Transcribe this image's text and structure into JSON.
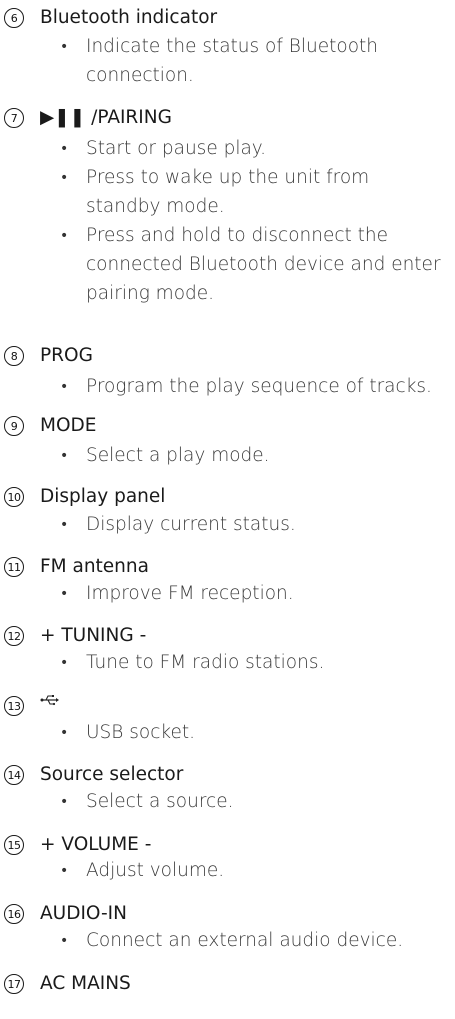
{
  "items": [
    {
      "number": "6",
      "title": "Bluetooth indicator",
      "bullets": [
        "Indicate the status of Bluetooth connection."
      ]
    },
    {
      "number": "7",
      "title": "▶❚❚ /PAIRING",
      "bullets": [
        "Start or pause play.",
        "Press to wake up the unit from standby mode.",
        "Press and hold to disconnect the connected Bluetooth device and enter pairing mode."
      ]
    },
    {
      "number": "8",
      "title": "PROG",
      "bullets": [
        "Program the play sequence of tracks."
      ]
    },
    {
      "number": "9",
      "title": "MODE",
      "bullets": [
        "Select a play mode."
      ]
    },
    {
      "number": "10",
      "title": "Display panel",
      "bullets": [
        "Display current status."
      ]
    },
    {
      "number": "11",
      "title": "FM antenna",
      "bullets": [
        "Improve FM reception."
      ]
    },
    {
      "number": "12",
      "title": "+ TUNING -",
      "bullets": [
        "Tune to FM radio stations."
      ]
    },
    {
      "number": "13",
      "title": "",
      "icon": "usb-icon",
      "bullets": [
        "USB socket."
      ]
    },
    {
      "number": "14",
      "title": "Source selector",
      "bullets": [
        "Select a source."
      ]
    },
    {
      "number": "15",
      "title": "+ VOLUME -",
      "bullets": [
        "Adjust volume."
      ]
    },
    {
      "number": "16",
      "title": "AUDIO-IN",
      "bullets": [
        "Connect an external audio device."
      ]
    },
    {
      "number": "17",
      "title": "AC MAINS",
      "bullets": []
    }
  ]
}
